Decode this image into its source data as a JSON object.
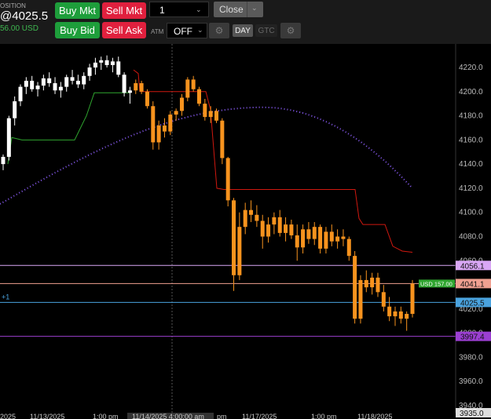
{
  "position": {
    "label": "OSITION",
    "price": "@4025.5",
    "pnl": "56.00 USD"
  },
  "toolbar": {
    "buy_mkt": "Buy Mkt",
    "sell_mkt": "Sell Mkt",
    "buy_bid": "Buy Bid",
    "sell_ask": "Sell Ask",
    "quantity": "1",
    "close": "Close",
    "atm_label": "ATM",
    "atm_value": "OFF",
    "tif_day": "DAY",
    "tif_gtc": "GTC"
  },
  "colors": {
    "bg": "#000000",
    "candle_up": "#ffffff",
    "candle_down": "#f7931e",
    "stop_line": "#d0180f",
    "trail_green": "#2fa52f",
    "ma_dots": "#8a5cf6"
  },
  "price_axis": {
    "ticks": [
      "4220.0",
      "4200.0",
      "4180.0",
      "4160.0",
      "4140.0",
      "4120.0",
      "4100.0",
      "4080.0",
      "4060.0",
      "4020.0",
      "4000.0",
      "3980.0",
      "3960.0",
      "3940.0"
    ]
  },
  "time_axis": {
    "ticks": [
      "2025",
      "11/13/2025",
      "1:00 pm",
      "11/14/2025 4:00:00 am",
      "pm",
      "11/17/2025",
      "1:00 pm",
      "11/18/2025"
    ]
  },
  "levels": [
    {
      "value": 4056.1,
      "label": "4056.1",
      "color": "#d9a7f5"
    },
    {
      "value": 4041.1,
      "label": "4041.1",
      "color": "#f0a091"
    },
    {
      "value": 4025.5,
      "label": "4025.5",
      "color": "#4aa3df"
    },
    {
      "value": 3997.4,
      "label": "3997.4",
      "color": "#9b3fd1"
    }
  ],
  "position_tag": "USD 157.00",
  "position_qty": "+1",
  "last_price_label": "3935.0",
  "chart_data": {
    "type": "candlestick",
    "ohlc": [
      [
        4140,
        4148,
        4135,
        4146
      ],
      [
        4146,
        4180,
        4143,
        4178
      ],
      [
        4178,
        4196,
        4172,
        4192
      ],
      [
        4192,
        4206,
        4188,
        4204
      ],
      [
        4204,
        4212,
        4198,
        4209
      ],
      [
        4209,
        4213,
        4200,
        4202
      ],
      [
        4202,
        4208,
        4196,
        4205
      ],
      [
        4205,
        4214,
        4201,
        4211
      ],
      [
        4211,
        4216,
        4204,
        4207
      ],
      [
        4207,
        4212,
        4198,
        4201
      ],
      [
        4201,
        4208,
        4195,
        4204
      ],
      [
        4204,
        4214,
        4200,
        4212
      ],
      [
        4212,
        4218,
        4206,
        4209
      ],
      [
        4209,
        4214,
        4203,
        4206
      ],
      [
        4206,
        4216,
        4202,
        4213
      ],
      [
        4213,
        4223,
        4209,
        4220
      ],
      [
        4220,
        4228,
        4214,
        4224
      ],
      [
        4224,
        4229,
        4218,
        4226
      ],
      [
        4226,
        4230,
        4220,
        4222
      ],
      [
        4222,
        4228,
        4216,
        4225
      ],
      [
        4225,
        4229,
        4212,
        4214
      ],
      [
        4214,
        4216,
        4196,
        4199
      ],
      [
        4199,
        4204,
        4190,
        4201
      ],
      [
        4201,
        4210,
        4198,
        4207
      ],
      [
        4207,
        4209,
        4198,
        4200
      ],
      [
        4200,
        4202,
        4186,
        4188
      ],
      [
        4188,
        4192,
        4152,
        4158
      ],
      [
        4158,
        4176,
        4152,
        4172
      ],
      [
        4172,
        4178,
        4162,
        4167
      ],
      [
        4167,
        4184,
        4164,
        4181
      ],
      [
        4181,
        4186,
        4176,
        4184
      ],
      [
        4184,
        4198,
        4180,
        4195
      ],
      [
        4195,
        4212,
        4192,
        4210
      ],
      [
        4210,
        4213,
        4200,
        4202
      ],
      [
        4202,
        4204,
        4188,
        4190
      ],
      [
        4190,
        4194,
        4176,
        4179
      ],
      [
        4179,
        4188,
        4174,
        4184
      ],
      [
        4184,
        4186,
        4174,
        4176
      ],
      [
        4176,
        4178,
        4140,
        4145
      ],
      [
        4145,
        4146,
        4105,
        4110
      ],
      [
        4110,
        4112,
        4035,
        4048
      ],
      [
        4048,
        4100,
        4044,
        4088
      ],
      [
        4088,
        4108,
        4082,
        4102
      ],
      [
        4102,
        4110,
        4092,
        4098
      ],
      [
        4098,
        4106,
        4088,
        4093
      ],
      [
        4093,
        4098,
        4070,
        4080
      ],
      [
        4080,
        4096,
        4075,
        4090
      ],
      [
        4090,
        4100,
        4082,
        4096
      ],
      [
        4096,
        4102,
        4080,
        4083
      ],
      [
        4083,
        4096,
        4076,
        4090
      ],
      [
        4090,
        4094,
        4078,
        4081
      ],
      [
        4081,
        4090,
        4060,
        4071
      ],
      [
        4071,
        4090,
        4066,
        4086
      ],
      [
        4086,
        4092,
        4074,
        4078
      ],
      [
        4078,
        4092,
        4073,
        4088
      ],
      [
        4088,
        4090,
        4066,
        4070
      ],
      [
        4070,
        4088,
        4066,
        4084
      ],
      [
        4084,
        4090,
        4072,
        4076
      ],
      [
        4076,
        4086,
        4070,
        4080
      ],
      [
        4080,
        4086,
        4072,
        4078
      ],
      [
        4078,
        4080,
        4060,
        4064
      ],
      [
        4064,
        4068,
        4008,
        4012
      ],
      [
        4012,
        4048,
        4008,
        4044
      ],
      [
        4044,
        4052,
        4034,
        4038
      ],
      [
        4038,
        4050,
        4032,
        4046
      ],
      [
        4046,
        4050,
        4030,
        4034
      ],
      [
        4034,
        4040,
        4018,
        4022
      ],
      [
        4022,
        4030,
        4010,
        4014
      ],
      [
        4014,
        4022,
        4006,
        4018
      ],
      [
        4018,
        4022,
        4008,
        4012
      ],
      [
        4012,
        4018,
        4002,
        4016
      ],
      [
        4016,
        4044,
        4013,
        4041
      ]
    ],
    "price_range": [
      3935,
      4240
    ]
  }
}
